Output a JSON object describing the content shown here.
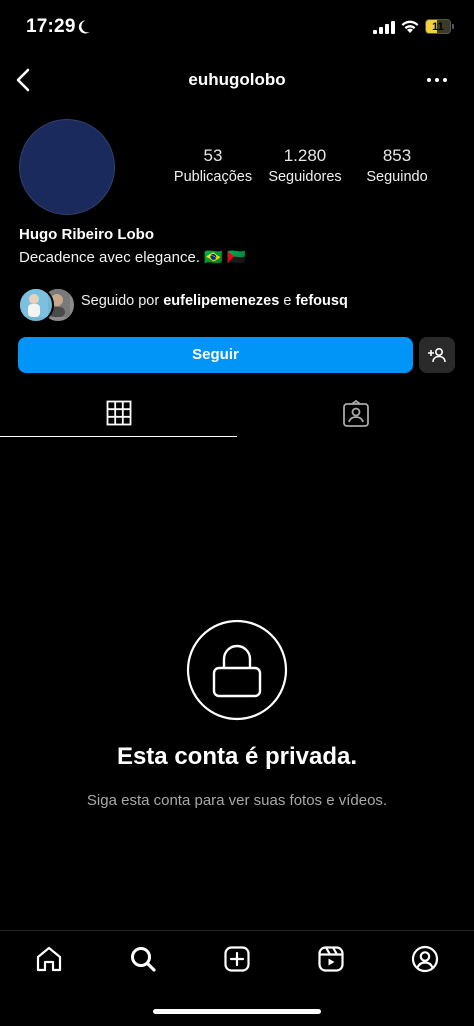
{
  "status_bar": {
    "time": "17:29",
    "battery": "11",
    "icons": [
      "moon-icon",
      "signal-icon",
      "wifi-icon",
      "battery-icon"
    ]
  },
  "header": {
    "username": "euhugolobo",
    "icons": [
      "back-arrow-icon",
      "more-options-icon"
    ]
  },
  "profile": {
    "stats": [
      {
        "value": "53",
        "label": "Publicações"
      },
      {
        "value": "1.280",
        "label": "Seguidores"
      },
      {
        "value": "853",
        "label": "Seguindo"
      }
    ],
    "name": "Hugo Ribeiro Lobo",
    "bio": "Decadence avec elegance. 🇧🇷 🇲🇶",
    "followed_by": {
      "prefix": "Seguido por",
      "user1": "eufelipemenezes",
      "conjunction": "e",
      "user2": "fefousq"
    },
    "follow_button": "Seguir"
  },
  "tabs": [
    "grid-icon",
    "tagged-icon"
  ],
  "private": {
    "title": "Esta conta é privada.",
    "subtitle": "Siga esta conta para ver suas fotos e vídeos."
  },
  "bottom_nav": [
    "home-icon",
    "search-icon",
    "create-icon",
    "reels-icon",
    "profile-icon"
  ],
  "colors": {
    "background": "#000000",
    "follow_button": "#0095f6",
    "avatar": "#1b2a5c",
    "secondary_text": "#a8a8a8"
  }
}
